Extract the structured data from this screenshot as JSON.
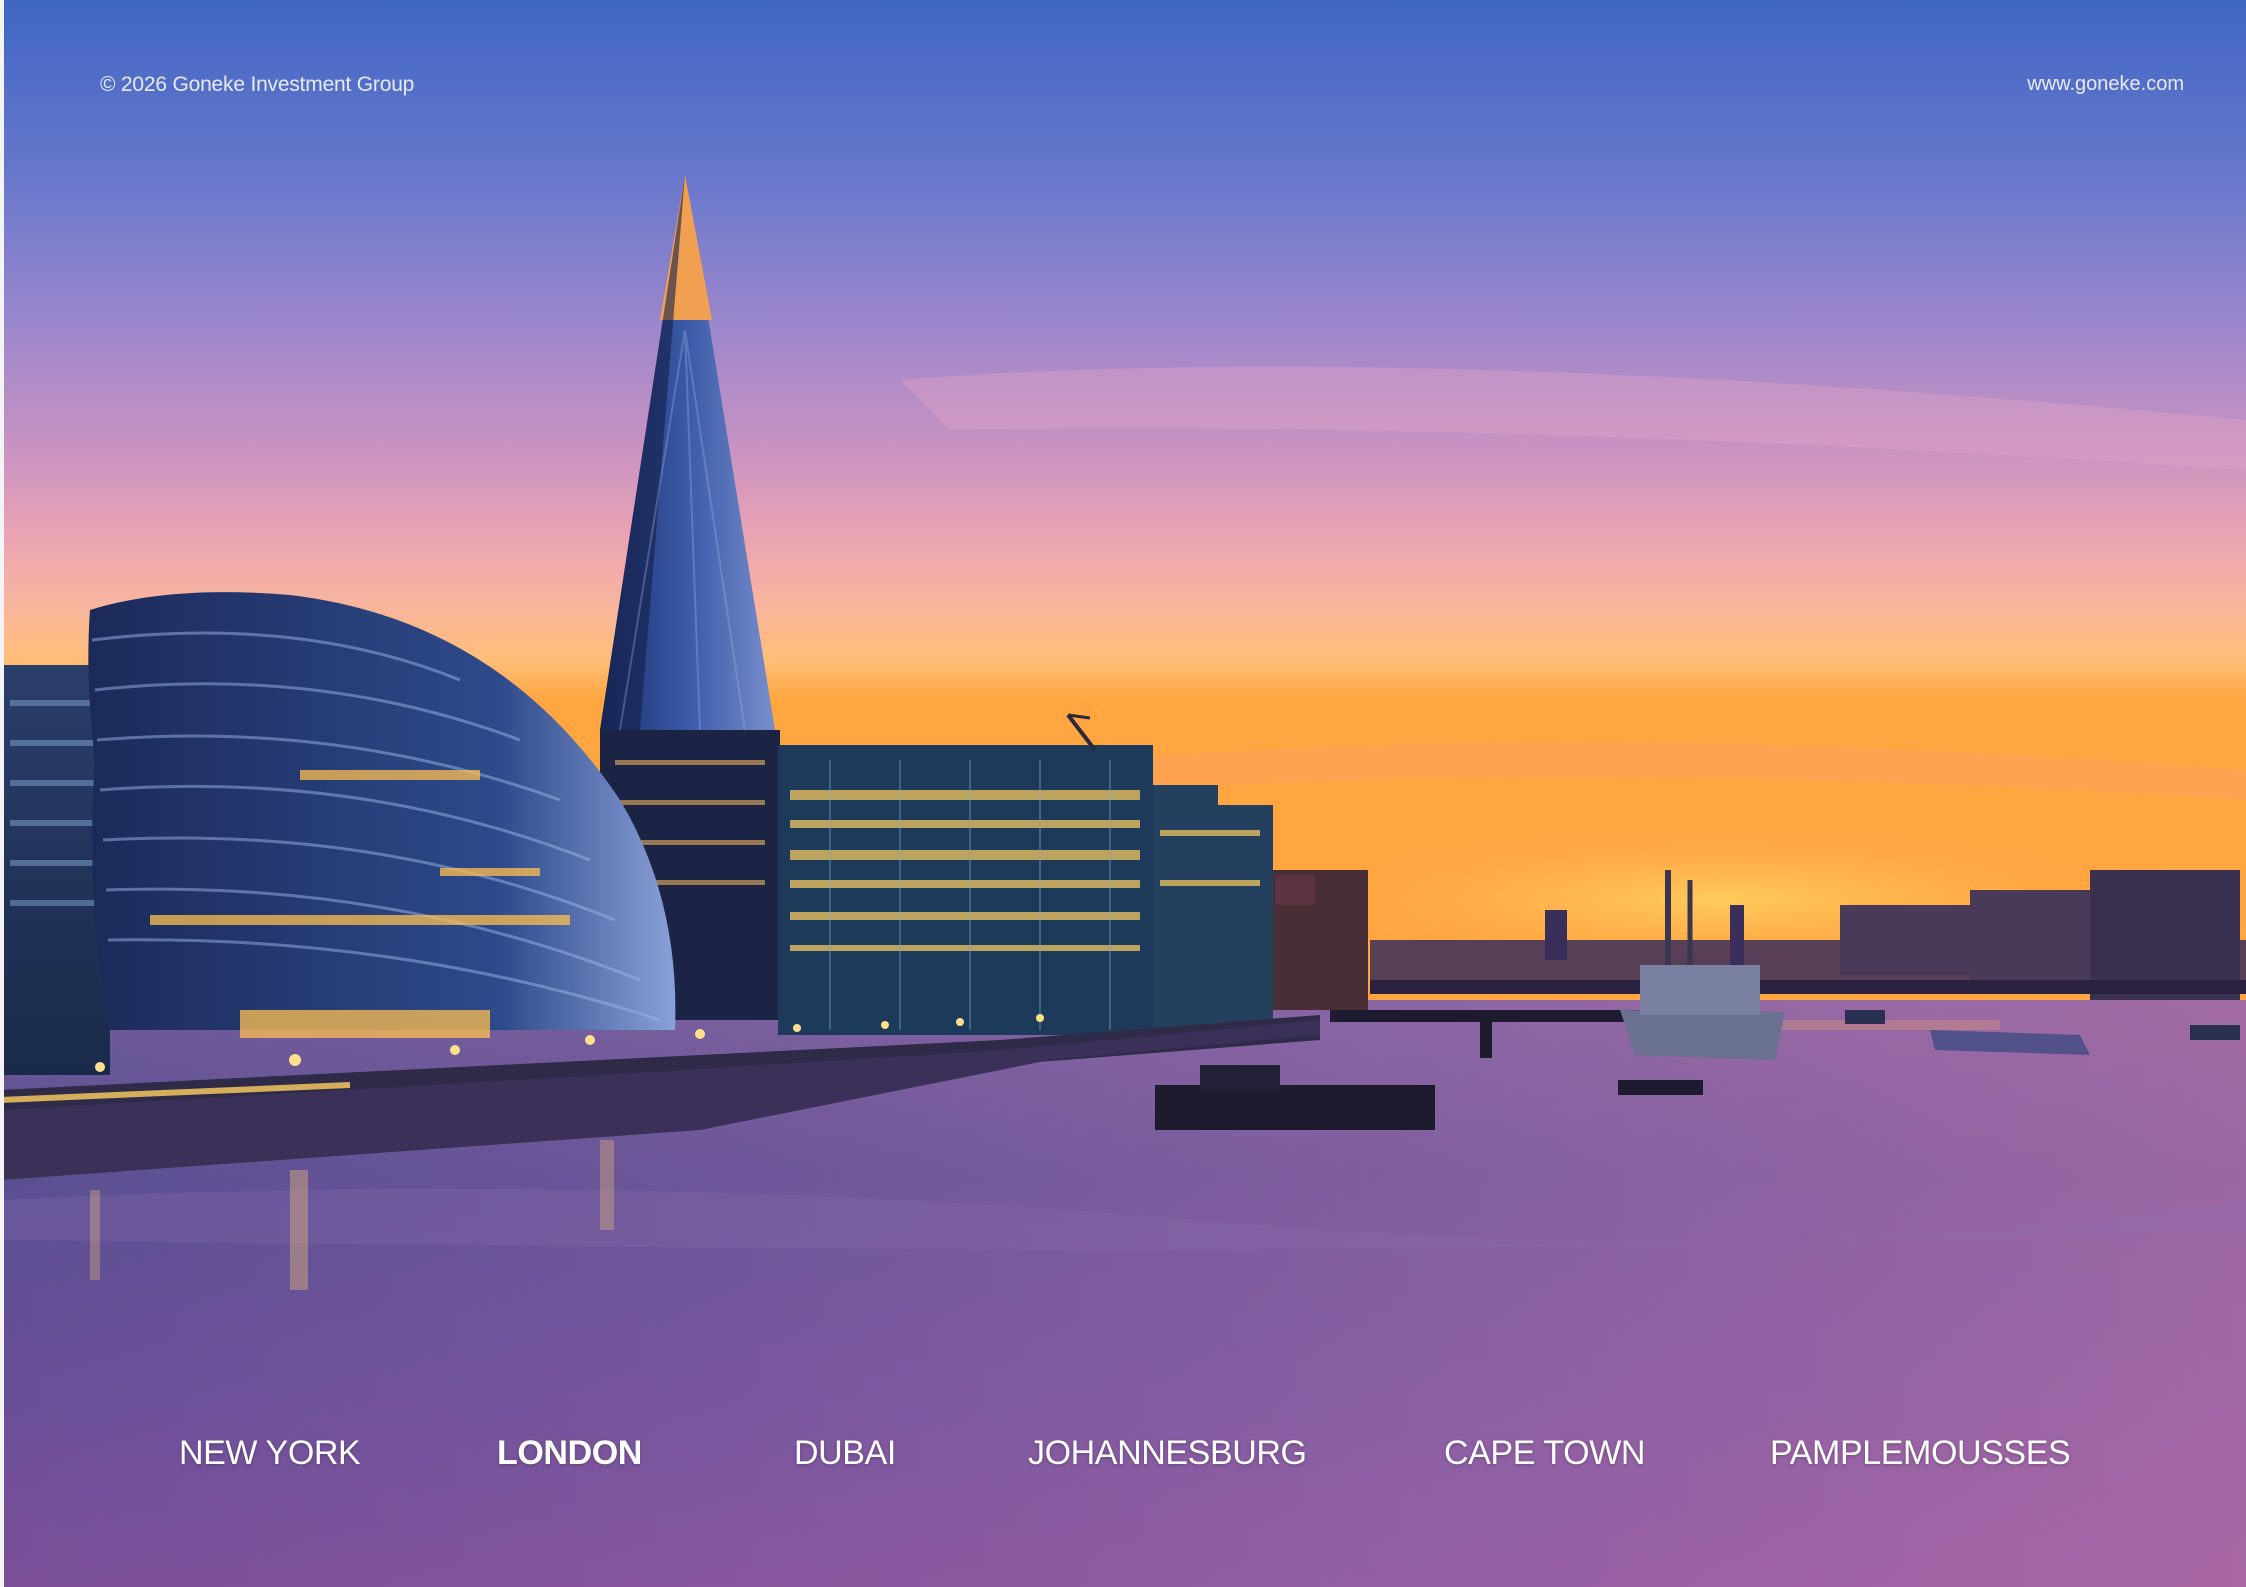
{
  "header": {
    "copyright": "© 2026 Goneke Investment Group",
    "website": "www.goneke.com"
  },
  "hero": {
    "image_description_icon": "london-skyline-image",
    "colors": {
      "sky_top": "#4a6fc8",
      "sky_mid": "#b08cc8",
      "sunset": "#ffb040",
      "water": "#5a4a88"
    }
  },
  "city_nav": {
    "items": [
      {
        "label": "NEW YORK",
        "active": false
      },
      {
        "label": "LONDON",
        "active": true
      },
      {
        "label": "DUBAI",
        "active": false
      },
      {
        "label": "JOHANNESBURG",
        "active": false
      },
      {
        "label": "CAPE TOWN",
        "active": false
      },
      {
        "label": "PAMPLEMOUSSES",
        "active": false
      }
    ]
  }
}
